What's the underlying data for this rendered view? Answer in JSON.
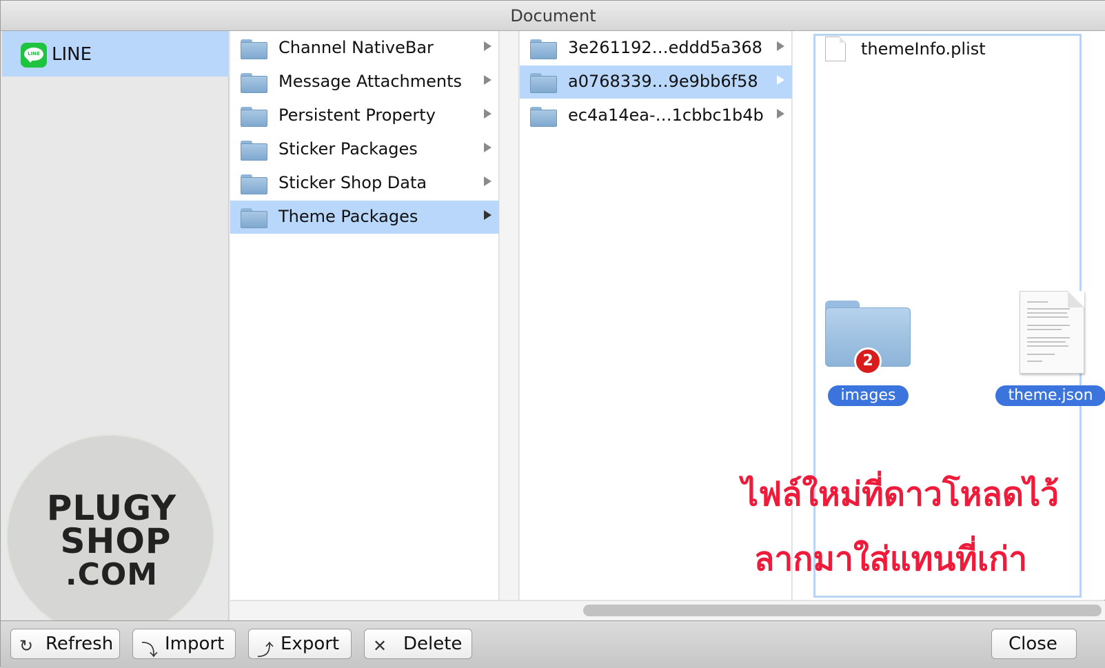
{
  "window": {
    "title": "Document"
  },
  "sidebar": {
    "items": [
      {
        "label": "LINE",
        "icon": "line-app-icon"
      }
    ]
  },
  "columns": {
    "col1": [
      {
        "label": "Channel NativeBar",
        "selected": false
      },
      {
        "label": "Message Attachments",
        "selected": false
      },
      {
        "label": "Persistent Property",
        "selected": false
      },
      {
        "label": "Sticker Packages",
        "selected": false
      },
      {
        "label": "Sticker Shop Data",
        "selected": false
      },
      {
        "label": "Theme Packages",
        "selected": true
      }
    ],
    "col2": [
      {
        "label": "3e261192…eddd5a368",
        "selected": false
      },
      {
        "label": "a0768339…9e9bb6f58",
        "selected": true
      },
      {
        "label": "ec4a14ea-…1cbbc1b4b",
        "selected": false
      }
    ],
    "col3": [
      {
        "label": "themeInfo.plist",
        "icon": "document-icon"
      }
    ]
  },
  "drag": {
    "folder_label": "images",
    "file_label": "theme.json",
    "badge_count": "2"
  },
  "annotation": {
    "line1": "ไฟล์ใหม่ที่ดาวโหลดไว้",
    "line2": "ลากมาใส่แทนที่เก่า",
    "color": "#ee1b3a"
  },
  "watermark": {
    "line1": "PLUGY",
    "line2": "SHOP",
    "line3": ".COM"
  },
  "toolbar": {
    "refresh": "Refresh",
    "import": "Import",
    "export": "Export",
    "delete": "Delete",
    "close": "Close"
  },
  "colors": {
    "selection": "#b9d6fb",
    "drag_pill": "#3b74dc",
    "line_green": "#1ec43f"
  }
}
